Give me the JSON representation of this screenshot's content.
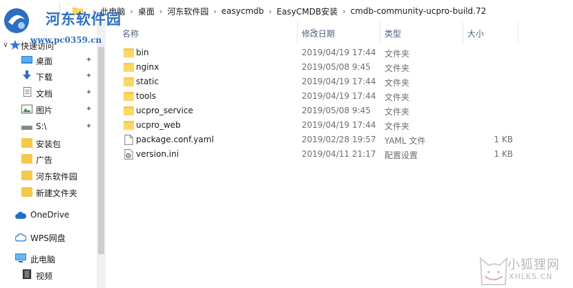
{
  "address_bar": {
    "crumbs": [
      "此电脑",
      "桌面",
      "河东软件园",
      "easycmdb",
      "EasyCMDB安装",
      "cmdb-community-ucpro-build.72"
    ]
  },
  "watermark_top": {
    "title": "河东软件园",
    "url": "www.pc0359.cn"
  },
  "sidebar": {
    "quick_access": "快速访问",
    "items": [
      {
        "label": "桌面",
        "icon": "desktop-icon",
        "pinned": true
      },
      {
        "label": "下载",
        "icon": "download-icon",
        "pinned": true
      },
      {
        "label": "文档",
        "icon": "document-icon",
        "pinned": true
      },
      {
        "label": "图片",
        "icon": "picture-icon",
        "pinned": true
      },
      {
        "label": "S:\\",
        "icon": "drive-icon",
        "pinned": true
      },
      {
        "label": "安装包",
        "icon": "folder-icon",
        "pinned": false
      },
      {
        "label": "广告",
        "icon": "folder-icon",
        "pinned": false
      },
      {
        "label": "河东软件园",
        "icon": "folder-icon",
        "pinned": false
      },
      {
        "label": "新建文件夹",
        "icon": "folder-icon",
        "pinned": false
      }
    ],
    "onedrive": "OneDrive",
    "wps": "WPS网盘",
    "this_pc": "此电脑",
    "video": "视频"
  },
  "columns": {
    "name": "名称",
    "date": "修改日期",
    "type": "类型",
    "size": "大小"
  },
  "files": [
    {
      "name": "bin",
      "date": "2019/04/19 17:44",
      "type": "文件夹",
      "size": "",
      "icon": "folder-icon"
    },
    {
      "name": "nginx",
      "date": "2019/05/08 9:45",
      "type": "文件夹",
      "size": "",
      "icon": "folder-icon"
    },
    {
      "name": "static",
      "date": "2019/04/19 17:44",
      "type": "文件夹",
      "size": "",
      "icon": "folder-icon"
    },
    {
      "name": "tools",
      "date": "2019/04/19 17:44",
      "type": "文件夹",
      "size": "",
      "icon": "folder-icon"
    },
    {
      "name": "ucpro_service",
      "date": "2019/05/08 9:45",
      "type": "文件夹",
      "size": "",
      "icon": "folder-icon"
    },
    {
      "name": "ucpro_web",
      "date": "2019/04/19 17:44",
      "type": "文件夹",
      "size": "",
      "icon": "folder-icon"
    },
    {
      "name": "package.conf.yaml",
      "date": "2019/02/28 19:57",
      "type": "YAML 文件",
      "size": "1 KB",
      "icon": "file-icon"
    },
    {
      "name": "version.ini",
      "date": "2019/04/11 21:17",
      "type": "配置设置",
      "size": "1 KB",
      "icon": "settings-file-icon"
    }
  ],
  "watermark_bottom": {
    "title": "小狐狸网",
    "url": "XHLKS.CN"
  },
  "colors": {
    "folder": "#f5c94a",
    "accent": "#2c6fc1",
    "header_text": "#4d6082"
  }
}
